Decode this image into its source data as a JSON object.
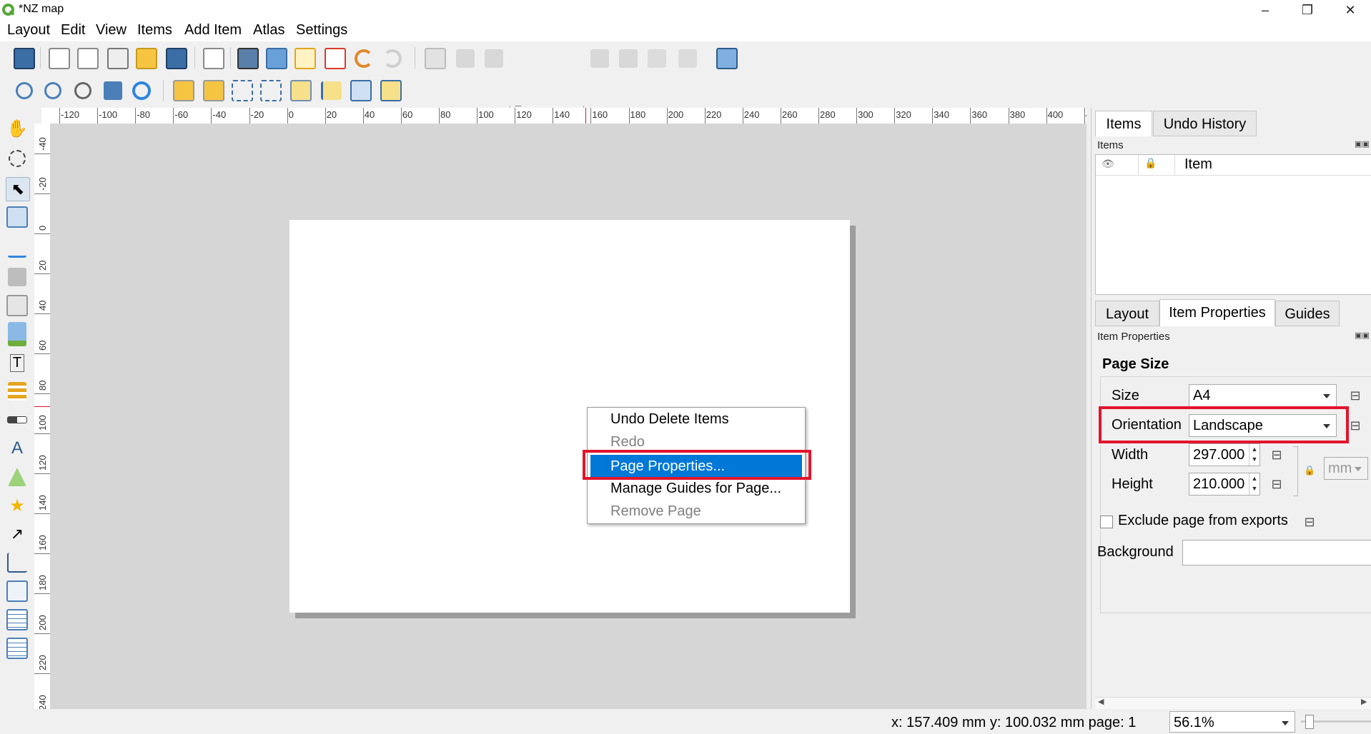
{
  "window": {
    "title": "*NZ map",
    "min": "–",
    "restore": "❐",
    "close": "✕"
  },
  "menubar": [
    "Layout",
    "Edit",
    "View",
    "Items",
    "Add Item",
    "Atlas",
    "Settings"
  ],
  "toolbar": {
    "page_value": "1"
  },
  "ruler": {
    "h_labels": [
      "-120",
      "-100",
      "-80",
      "-60",
      "-40",
      "-20",
      "0",
      "20",
      "40",
      "60",
      "80",
      "100",
      "120",
      "140",
      "160",
      "180",
      "200",
      "220",
      "240",
      "260",
      "280",
      "300",
      "320",
      "340",
      "360",
      "380",
      "400",
      "4"
    ],
    "v_labels": [
      "-40",
      "-20",
      "0",
      "20",
      "40",
      "60",
      "80",
      "100",
      "120",
      "140",
      "160",
      "180",
      "200",
      "220",
      "240"
    ]
  },
  "context_menu": {
    "items": [
      {
        "label": "Undo Delete Items",
        "enabled": true
      },
      {
        "label": "Redo",
        "enabled": false
      },
      {
        "label": "Page Properties...",
        "enabled": true,
        "selected": true
      },
      {
        "label": "Manage Guides for Page...",
        "enabled": true
      },
      {
        "label": "Remove Page",
        "enabled": false
      }
    ]
  },
  "right_panel": {
    "top_tabs": [
      "Items",
      "Undo History"
    ],
    "items_title": "Items",
    "items_columns": {
      "visible_icon": "eye-icon",
      "lock_icon": "lock-icon",
      "item": "Item"
    },
    "bottom_tabs": [
      "Layout",
      "Item Properties",
      "Guides"
    ],
    "props_title": "Item Properties",
    "page_size": {
      "heading": "Page Size",
      "size_label": "Size",
      "size_value": "A4",
      "orientation_label": "Orientation",
      "orientation_value": "Landscape",
      "width_label": "Width",
      "width_value": "297.000",
      "height_label": "Height",
      "height_value": "210.000",
      "units": "mm"
    },
    "exclude_label": "Exclude page from exports",
    "background_label": "Background"
  },
  "status": {
    "coords": "x: 157.409 mm y: 100.032 mm page: 1",
    "zoom": "56.1%"
  },
  "colors": {
    "selection": "#0078d7",
    "highlight": "#e2142d",
    "canvas": "#d6d6d6"
  }
}
